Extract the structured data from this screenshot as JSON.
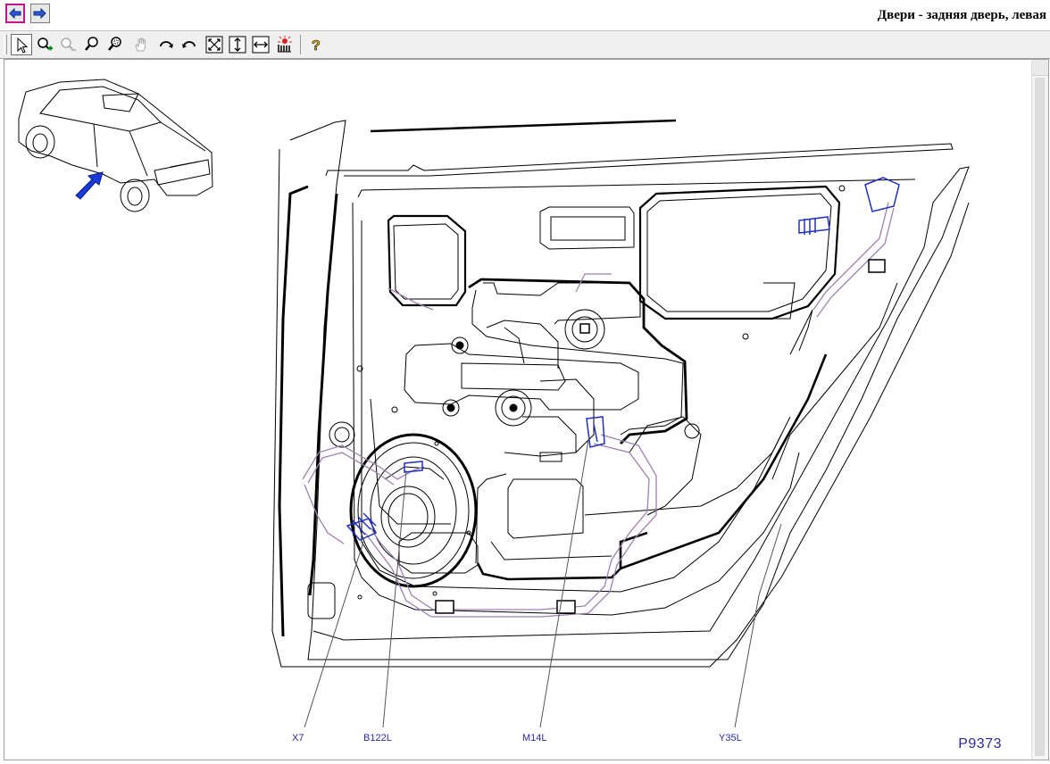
{
  "window": {
    "title": "Двери - задняя дверь, левая"
  },
  "nav": {
    "back_icon": "arrow-left-icon",
    "forward_icon": "arrow-right-icon"
  },
  "toolbar": {
    "tools": [
      {
        "name": "select-tool",
        "icon": "pointer-icon"
      },
      {
        "name": "zoom-in-tool",
        "icon": "zoom-in-icon"
      },
      {
        "name": "zoom-out-tool",
        "icon": "zoom-out-icon"
      },
      {
        "name": "zoom-tool",
        "icon": "magnifier-icon"
      },
      {
        "name": "zoom-window-tool",
        "icon": "zoom-window-icon"
      },
      {
        "name": "pan-tool",
        "icon": "hand-icon"
      },
      {
        "name": "rotate-cw-tool",
        "icon": "rotate-cw-icon"
      },
      {
        "name": "rotate-ccw-tool",
        "icon": "rotate-ccw-icon"
      },
      {
        "name": "fit-all-tool",
        "icon": "fit-all-icon"
      },
      {
        "name": "fit-height-tool",
        "icon": "fit-height-icon"
      },
      {
        "name": "fit-width-tool",
        "icon": "fit-width-icon"
      },
      {
        "name": "highlight-tool",
        "icon": "highlight-icon"
      },
      {
        "name": "help-tool",
        "icon": "help-icon"
      }
    ]
  },
  "diagram": {
    "id": "P9373",
    "callouts": [
      "X7",
      "B122L",
      "M14L",
      "Y35L"
    ]
  },
  "colors": {
    "callout": "#2a2aa0",
    "arrow": "#1a3ad8",
    "harness": "#a080b0",
    "connector": "#2030c0"
  }
}
